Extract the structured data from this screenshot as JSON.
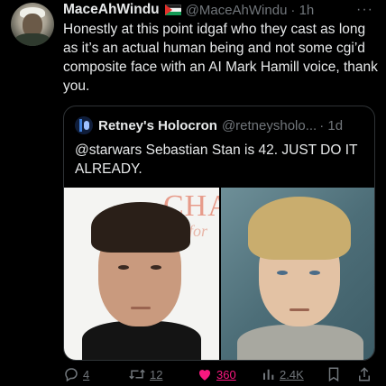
{
  "tweet": {
    "author_name": "MaceAhWindu",
    "author_handle": "@MaceAhWindu",
    "time": "· 1h",
    "more": "···",
    "text": "Honestly at this point idgaf who they cast as long as it’s an actual human being and not some cgi’d composite face with an AI Mark Hamill voice, thank you."
  },
  "quote": {
    "author_name": "Retney's Holocron",
    "author_handle": "@retneysholo...",
    "time": "· 1d",
    "text": "@starwars Sebastian Stan is 42. JUST DO IT ALREADY.",
    "photo_left_text_1": "CHA",
    "photo_left_text_2": "for"
  },
  "actions": {
    "reply_count": "4",
    "retweet_count": "12",
    "like_count": "360",
    "views_count": "2.4K"
  },
  "colors": {
    "like": "#f91880",
    "muted": "#71767b",
    "text": "#e7e9ea"
  },
  "icons": [
    "reply-icon",
    "retweet-icon",
    "heart-icon",
    "views-icon",
    "bookmark-icon",
    "share-icon"
  ]
}
